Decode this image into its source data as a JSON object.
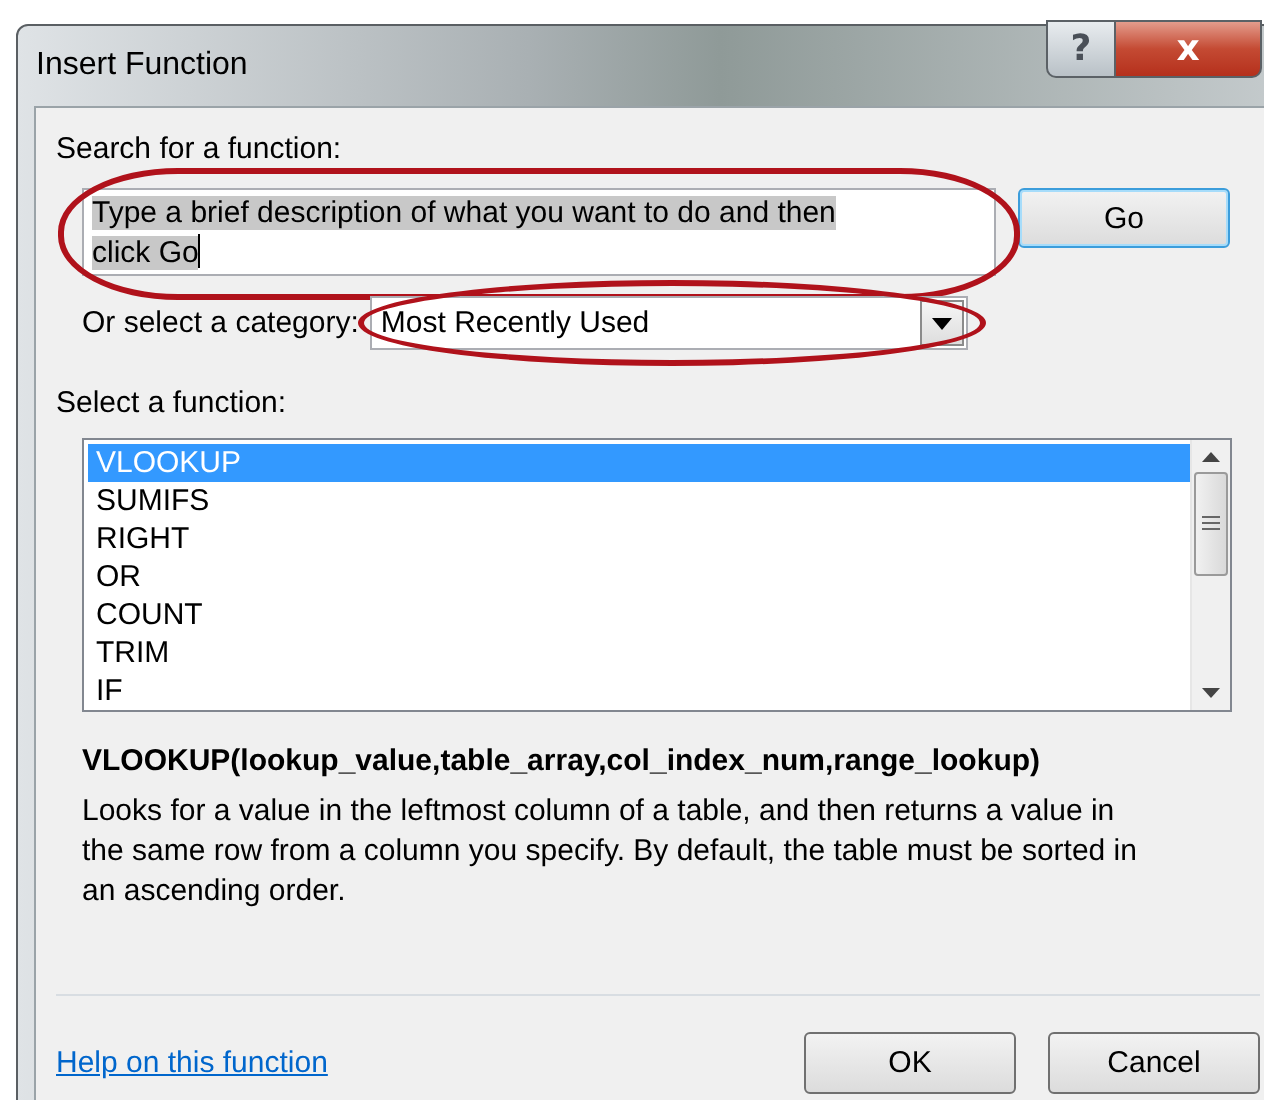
{
  "window": {
    "title": "Insert Function",
    "help_button": "?",
    "close_button": "x"
  },
  "search": {
    "label": "Search for a function:",
    "value": "Type a brief description of what you want to do and then click Go",
    "text_selected": true,
    "highlighted": true,
    "go_button": "Go"
  },
  "category": {
    "label": "Or select a category:",
    "value": "Most Recently Used",
    "highlighted": true
  },
  "function_list": {
    "label": "Select a function:",
    "items": [
      {
        "name": "VLOOKUP",
        "selected": true
      },
      {
        "name": "SUMIFS",
        "selected": false
      },
      {
        "name": "RIGHT",
        "selected": false
      },
      {
        "name": "OR",
        "selected": false
      },
      {
        "name": "COUNT",
        "selected": false
      },
      {
        "name": "TRIM",
        "selected": false
      },
      {
        "name": "IF",
        "selected": false
      }
    ]
  },
  "signature": "VLOOKUP(lookup_value,table_array,col_index_num,range_lookup)",
  "description": "Looks for a value in the leftmost column of a table, and then returns a value in the same row from a column you specify. By default, the table must be sorted in an ascending order.",
  "help_link": "Help on this function",
  "buttons": [
    "OK",
    "Cancel"
  ]
}
